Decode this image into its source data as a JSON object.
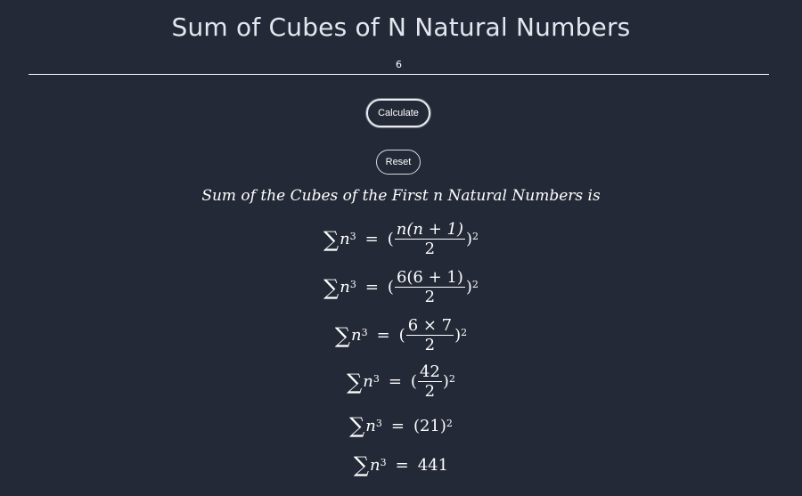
{
  "title": "Sum of Cubes of N Natural Numbers",
  "input": {
    "value": "6"
  },
  "buttons": {
    "calculate": "Calculate",
    "reset": "Reset"
  },
  "result": {
    "heading": "Sum of the Cubes of the First n Natural Numbers is",
    "sigma": "∑",
    "var": "n",
    "power": "3",
    "equals": "=",
    "open": "(",
    "close": ")",
    "square": "2",
    "lines": {
      "l1_num": "n(n + 1)",
      "l1_den": "2",
      "l2_num": "6(6 + 1)",
      "l2_den": "2",
      "l3_num": "6 × 7",
      "l3_den": "2",
      "l4_num": "42",
      "l4_den": "2",
      "l5_val": "(21)",
      "l6_val": "441"
    }
  }
}
